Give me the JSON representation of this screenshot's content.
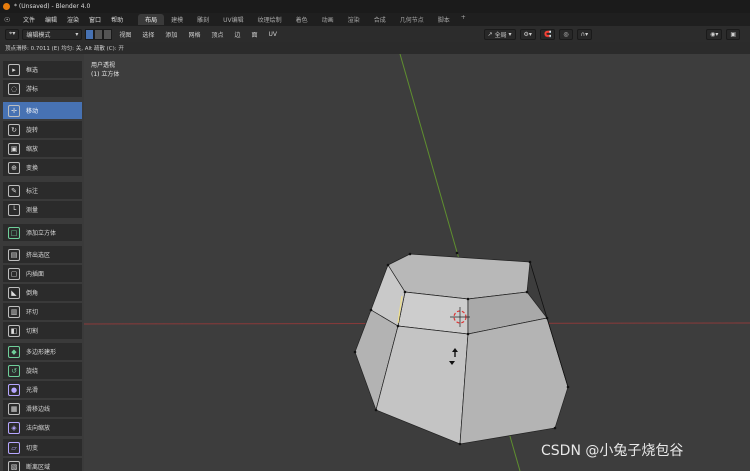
{
  "window": {
    "title": "* (Unsaved) - Blender 4.0"
  },
  "menu": [
    "文件",
    "编辑",
    "渲染",
    "窗口",
    "帮助"
  ],
  "workspace_tabs": [
    "布局",
    "建模",
    "雕刻",
    "UV编辑",
    "纹理绘制",
    "着色",
    "动画",
    "渲染",
    "合成",
    "几何节点",
    "脚本"
  ],
  "workspace_active": "布局",
  "add_tab": "+",
  "header": {
    "mode": "编辑模式",
    "menus": [
      "视图",
      "选择",
      "添加",
      "网格",
      "顶点",
      "边",
      "面",
      "UV"
    ],
    "orientation": "全局"
  },
  "status": "顶点滑移: 0.7011 (E) 均匀: 关, Alt 疏散 (C): 开",
  "tools": [
    {
      "label": "框选",
      "icon": "select-box-icon"
    },
    {
      "label": "游标",
      "icon": "cursor-icon"
    },
    {
      "label": "移动",
      "icon": "move-icon",
      "active": true
    },
    {
      "label": "旋转",
      "icon": "rotate-icon"
    },
    {
      "label": "缩放",
      "icon": "scale-icon"
    },
    {
      "label": "变换",
      "icon": "transform-icon"
    },
    {
      "label": "标注",
      "icon": "annotate-icon"
    },
    {
      "label": "测量",
      "icon": "measure-icon"
    },
    {
      "label": "添加立方体",
      "icon": "add-cube-icon"
    },
    {
      "label": "挤出选区",
      "icon": "extrude-icon"
    },
    {
      "label": "内插面",
      "icon": "inset-icon"
    },
    {
      "label": "倒角",
      "icon": "bevel-icon"
    },
    {
      "label": "环切",
      "icon": "loop-cut-icon"
    },
    {
      "label": "切割",
      "icon": "knife-icon"
    },
    {
      "label": "多边形建形",
      "icon": "poly-build-icon"
    },
    {
      "label": "旋绕",
      "icon": "spin-icon"
    },
    {
      "label": "光滑",
      "icon": "smooth-icon"
    },
    {
      "label": "滑移边线",
      "icon": "edge-slide-icon"
    },
    {
      "label": "法向缩放",
      "icon": "shrink-icon"
    },
    {
      "label": "切变",
      "icon": "shear-icon"
    },
    {
      "label": "断离区域",
      "icon": "rip-icon"
    }
  ],
  "viewport": {
    "view_name": "用户透视",
    "object_name": "(1) 立方体"
  },
  "watermark": "CSDN @小兔子烧包谷"
}
